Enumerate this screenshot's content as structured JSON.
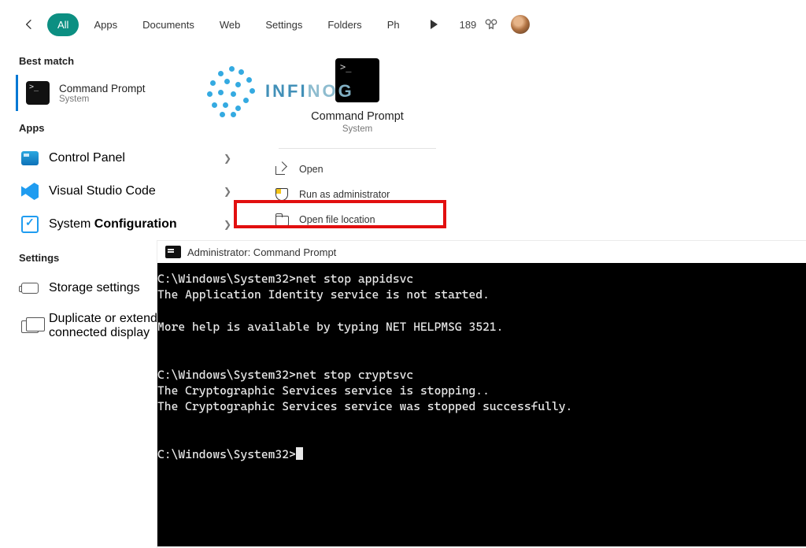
{
  "topbar": {
    "pills": [
      "All",
      "Apps",
      "Documents",
      "Web",
      "Settings",
      "Folders",
      "Ph"
    ],
    "points": "189"
  },
  "left": {
    "best_match_label": "Best match",
    "match": {
      "title": "Command Prompt",
      "sub": "System"
    },
    "apps_label": "Apps",
    "apps": [
      {
        "label": "Control Panel"
      },
      {
        "label": "Visual Studio Code"
      }
    ],
    "sys_config_pre": "System ",
    "sys_config_bold": "Configuration",
    "settings_label": "Settings",
    "settings": [
      {
        "label": "Storage settings"
      },
      {
        "label": "Duplicate or extend to a connected display"
      }
    ]
  },
  "detail": {
    "title": "Command Prompt",
    "sub": "System",
    "actions": {
      "open": "Open",
      "runadmin": "Run as administrator",
      "openloc": "Open file location"
    }
  },
  "console": {
    "title": "Administrator: Command Prompt",
    "body": "C:\\Windows\\System32>net stop appidsvc\nThe Application Identity service is not started.\n\nMore help is available by typing NET HELPMSG 3521.\n\n\nC:\\Windows\\System32>net stop cryptsvc\nThe Cryptographic Services service is stopping..\nThe Cryptographic Services service was stopped successfully.\n\n\nC:\\Windows\\System32>"
  },
  "watermark": {
    "a": "INFI",
    "b": "NOG"
  }
}
